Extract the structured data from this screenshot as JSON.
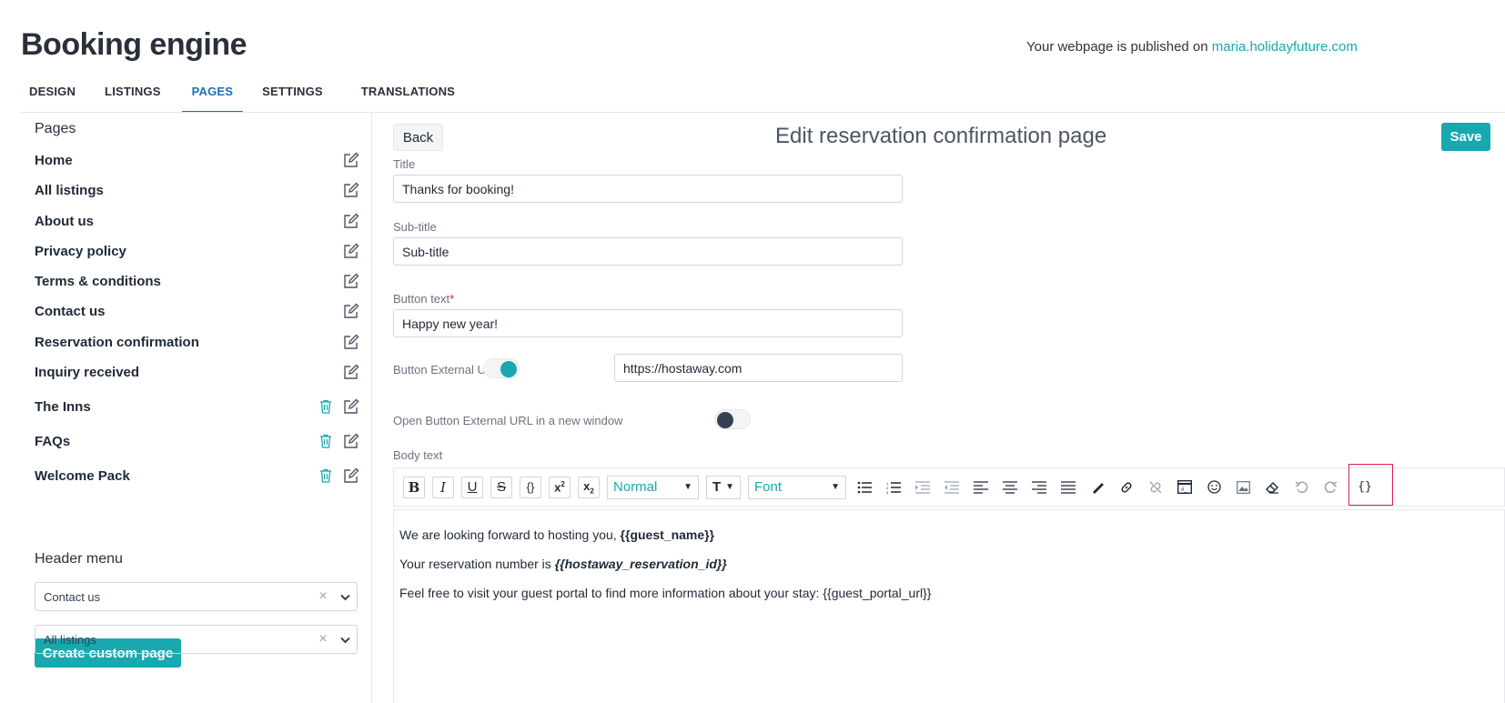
{
  "header": {
    "title": "Booking engine",
    "published_prefix": "Your webpage is published on",
    "published_link": "maria.holidayfuture.com"
  },
  "tabs": [
    {
      "label": "DESIGN",
      "active": false
    },
    {
      "label": "LISTINGS",
      "active": false
    },
    {
      "label": "PAGES",
      "active": true
    },
    {
      "label": "SETTINGS",
      "active": false
    },
    {
      "label": "TRANSLATIONS",
      "active": false
    }
  ],
  "sidebar": {
    "pages_heading": "Pages",
    "items": [
      {
        "label": "Home",
        "deletable": false
      },
      {
        "label": "All listings",
        "deletable": false
      },
      {
        "label": "About us",
        "deletable": false
      },
      {
        "label": "Privacy policy",
        "deletable": false
      },
      {
        "label": "Terms & conditions",
        "deletable": false
      },
      {
        "label": "Contact us",
        "deletable": false
      },
      {
        "label": "Reservation confirmation",
        "deletable": false
      },
      {
        "label": "Inquiry received",
        "deletable": false
      },
      {
        "label": "The Inns",
        "deletable": true
      },
      {
        "label": "FAQs",
        "deletable": true
      },
      {
        "label": "Welcome Pack",
        "deletable": true
      }
    ],
    "create_button": "Create custom page",
    "header_menu_heading": "Header menu",
    "header_menu_selects": [
      "Contact us",
      "All listings"
    ]
  },
  "editor": {
    "back_label": "Back",
    "title": "Edit reservation confirmation page",
    "save_label": "Save",
    "fields": {
      "title_label": "Title",
      "title_value": "Thanks for booking!",
      "subtitle_label": "Sub-title",
      "subtitle_value": "Sub-title",
      "button_text_label": "Button text",
      "button_text_required": "*",
      "button_text_value": "Happy new year!",
      "external_url_label": "Button External URL",
      "external_url_enabled": true,
      "external_url_value": "https://hostaway.com",
      "new_window_label": "Open Button External URL in a new window",
      "new_window_enabled": false,
      "body_label": "Body text"
    },
    "toolbar": {
      "format_value": "Normal",
      "font_value": "Font"
    },
    "body": {
      "line1_text": "We are looking forward to hosting you, ",
      "line1_var": "{{guest_name}}",
      "line2_text": "Your reservation number is ",
      "line2_var": "{{hostaway_reservation_id}}",
      "line3_text": "Feel free to visit your guest portal to find more information about your stay: {{guest_portal_url}}"
    }
  },
  "colors": {
    "accent": "#17a8b0",
    "active_tab": "#1f6fb5",
    "highlight": "#e11d48"
  }
}
